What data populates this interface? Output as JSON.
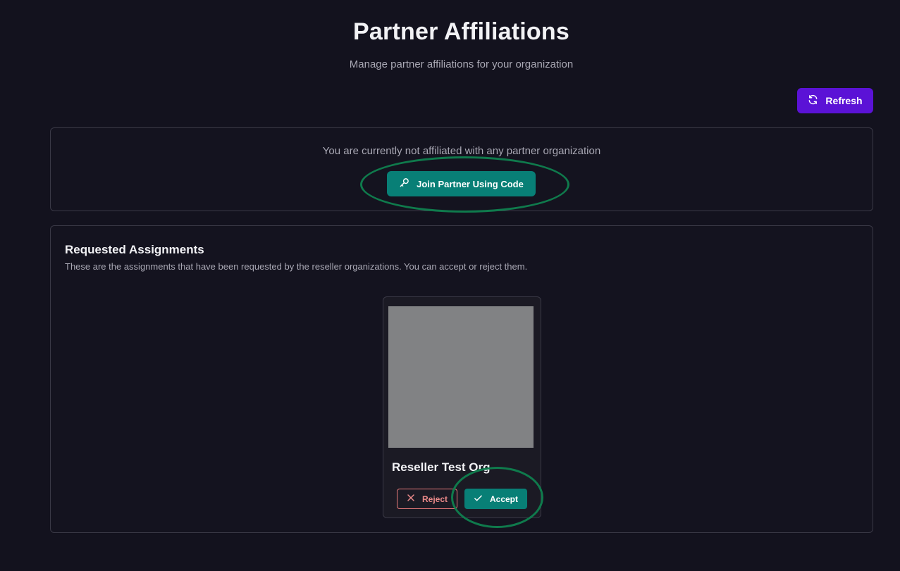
{
  "header": {
    "title": "Partner Affiliations",
    "subtitle": "Manage partner affiliations for your organization"
  },
  "toolbar": {
    "refresh_label": "Refresh",
    "refresh_icon": "refresh-icon",
    "refresh_color": "#5b12d6"
  },
  "affiliation": {
    "status_text": "You are currently not affiliated with any partner organization",
    "join_label": "Join Partner Using Code",
    "join_icon": "key-icon",
    "join_color": "#087f76"
  },
  "requests": {
    "title": "Requested Assignments",
    "description": "These are the assignments that have been requested by the reseller organizations. You can accept or reject them.",
    "items": [
      {
        "org_name": "Reseller Test Org",
        "reject_label": "Reject",
        "reject_icon": "close-icon",
        "accept_label": "Accept",
        "accept_icon": "check-icon"
      }
    ]
  },
  "theme": {
    "background": "#13121e",
    "border": "#3a3946",
    "highlight_ring": "#0f7a4c",
    "reject_color": "#ec8a8a"
  }
}
